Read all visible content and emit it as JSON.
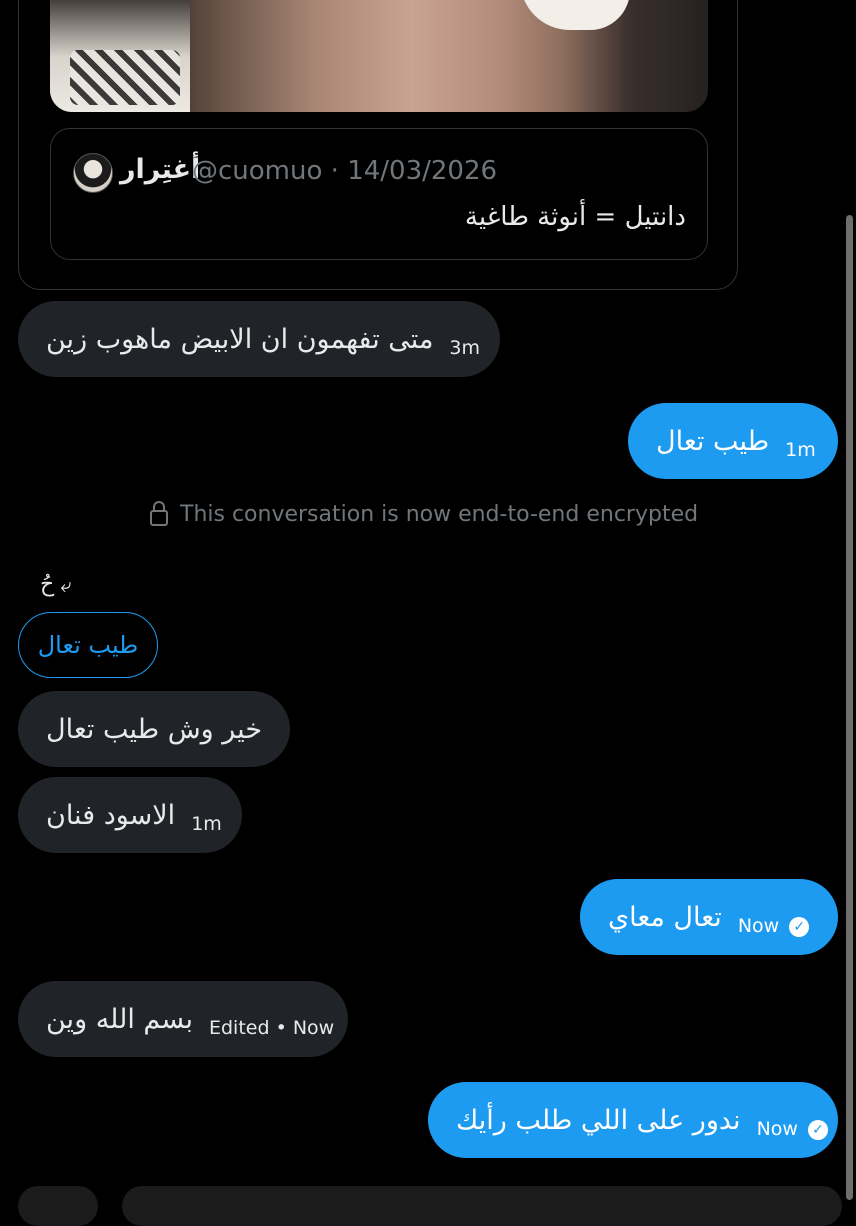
{
  "quoted_post": {
    "author_name": "أغتِرار",
    "handle": "@cuomuo",
    "separator": "·",
    "date": "14/03/2026",
    "text": "دانتيل = أنوثة طاغية"
  },
  "messages": [
    {
      "direction": "in",
      "text": "متى تفهمون ان الابيض ماهوب زين",
      "time": "3m"
    },
    {
      "direction": "out",
      "text": "طيب تعال",
      "time": "1m"
    },
    {
      "direction": "in",
      "text": "خير وش طيب تعال",
      "time": ""
    },
    {
      "direction": "in",
      "text": "الاسود فنان",
      "time": "1m"
    },
    {
      "direction": "out",
      "text": "تعال معاي",
      "time": "Now"
    },
    {
      "direction": "in",
      "text": "بسم الله وين",
      "time": "Edited • Now"
    },
    {
      "direction": "out",
      "text": "ندور على اللي طلب رأيك",
      "time": "Now"
    }
  ],
  "encryption_notice": "This conversation is now end-to-end encrypted",
  "reply_context": {
    "label": "حُ",
    "quoted_text": "طيب تعال"
  },
  "icons": {
    "lock": "lock-icon",
    "reply": "reply-arrow-icon",
    "read": "check-circle-icon"
  },
  "colors": {
    "background": "#000000",
    "incoming_bubble": "#202327",
    "outgoing_bubble": "#1d9bf0",
    "muted_text": "#71767b"
  }
}
